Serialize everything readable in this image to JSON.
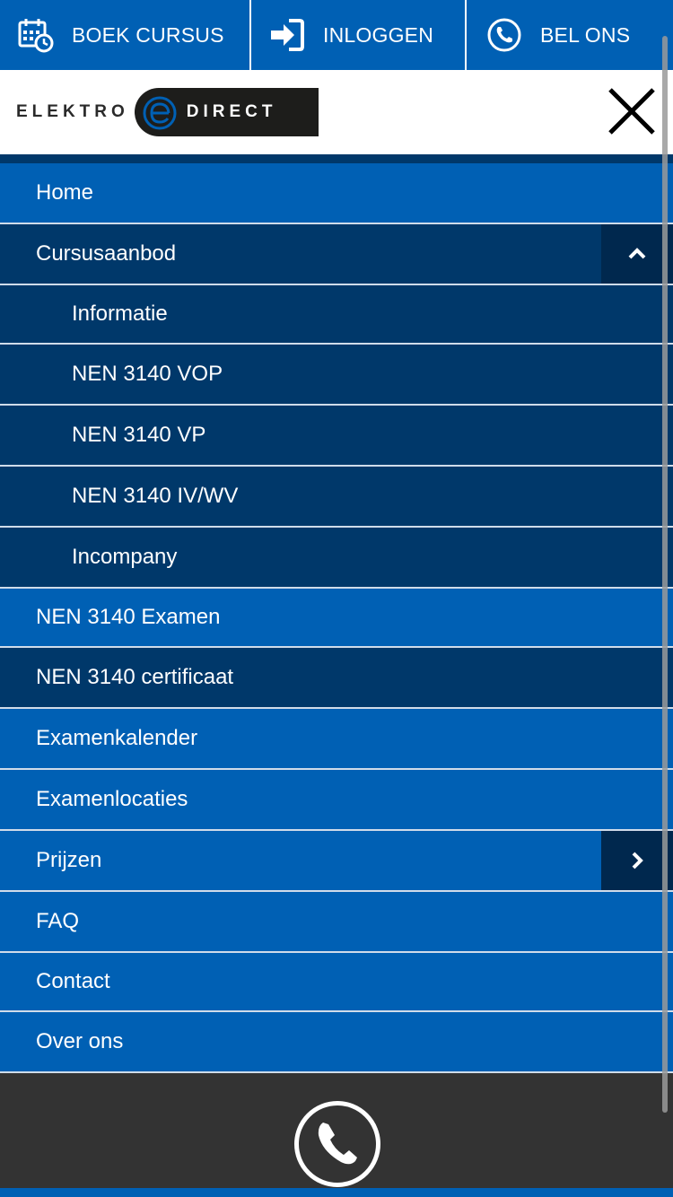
{
  "topbar": {
    "book": {
      "label": "BOEK CURSUS",
      "icon": "calendar-clock-icon"
    },
    "login": {
      "label": "INLOGGEN",
      "icon": "sign-in-icon"
    },
    "call": {
      "label": "BEL ONS",
      "icon": "phone-icon"
    }
  },
  "brand": {
    "left": "ELEKTRO",
    "right": "DIRECT"
  },
  "menu": {
    "items": [
      {
        "label": "Home"
      },
      {
        "label": "Cursusaanbod"
      },
      {
        "label": "Informatie"
      },
      {
        "label": "NEN 3140 VOP"
      },
      {
        "label": "NEN 3140 VP"
      },
      {
        "label": "NEN 3140 IV/WV"
      },
      {
        "label": "Incompany"
      },
      {
        "label": "NEN 3140 Examen"
      },
      {
        "label": "NEN 3140 certificaat"
      },
      {
        "label": "Examenkalender"
      },
      {
        "label": "Examenlocaties"
      },
      {
        "label": "Prijzen"
      },
      {
        "label": "FAQ"
      },
      {
        "label": "Contact"
      },
      {
        "label": "Over ons"
      }
    ]
  },
  "colors": {
    "primary": "#0060b4",
    "dark": "#00386a",
    "darker": "#00284e",
    "footer": "#333333"
  }
}
